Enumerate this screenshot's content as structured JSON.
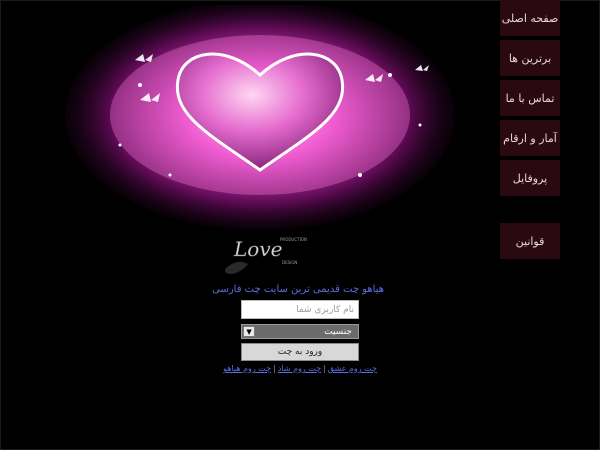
{
  "nav": {
    "items": [
      {
        "label": "صفحه اصلی"
      },
      {
        "label": "برترین ها"
      },
      {
        "label": "تماس با ما"
      },
      {
        "label": "آمار و ارقام"
      },
      {
        "label": "پروفایل"
      },
      {
        "label": "قوانین"
      }
    ]
  },
  "logo": {
    "text": "Love",
    "small_top": "PRODUCTION",
    "small_bottom": "DESIGN"
  },
  "tagline": "هیاهو چت قدیمی ترین سایت چت فارسی",
  "form": {
    "username_placeholder": "نام کاربری شما",
    "username_value": "",
    "gender_selected": "جنسیت",
    "submit_label": "ورود به چت"
  },
  "links": [
    "چت روم عشق",
    "چت روم شاد",
    "چت روم هیاهو"
  ],
  "colors": {
    "background": "#000000",
    "nav_bg": "#2a0a10",
    "link": "#5a6de0",
    "glow_pink": "#ff6ad8"
  }
}
